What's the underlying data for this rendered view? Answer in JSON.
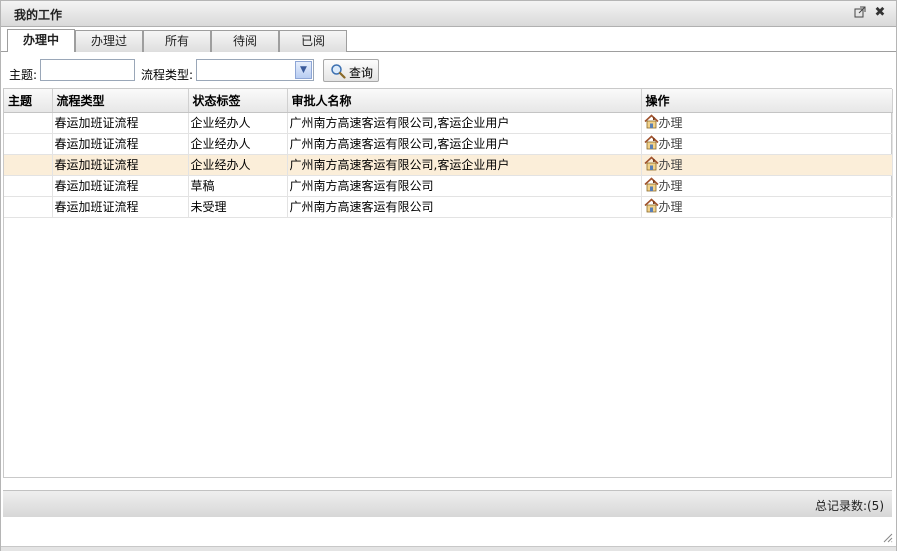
{
  "window": {
    "title": "我的工作"
  },
  "tabs": [
    {
      "label": "办理中",
      "active": true
    },
    {
      "label": "办理过",
      "active": false
    },
    {
      "label": "所有",
      "active": false
    },
    {
      "label": "待阅",
      "active": false
    },
    {
      "label": "已阅",
      "active": false
    }
  ],
  "search": {
    "subject_label": "主题:",
    "subject_value": "",
    "type_label": "流程类型:",
    "type_value": "",
    "query_button": "查询"
  },
  "table": {
    "headers": [
      "主题",
      "流程类型",
      "状态标签",
      "审批人名称",
      "操作"
    ],
    "rows": [
      {
        "subject": "",
        "type": "春运加班证流程",
        "status": "企业经办人",
        "approver": "广州南方高速客运有限公司,客运企业用户",
        "action": "办理",
        "highlighted": false
      },
      {
        "subject": "",
        "type": "春运加班证流程",
        "status": "企业经办人",
        "approver": "广州南方高速客运有限公司,客运企业用户",
        "action": "办理",
        "highlighted": false
      },
      {
        "subject": "",
        "type": "春运加班证流程",
        "status": "企业经办人",
        "approver": "广州南方高速客运有限公司,客运企业用户",
        "action": "办理",
        "highlighted": true
      },
      {
        "subject": "",
        "type": "春运加班证流程",
        "status": "草稿",
        "approver": "广州南方高速客运有限公司",
        "action": "办理",
        "highlighted": false
      },
      {
        "subject": "",
        "type": "春运加班证流程",
        "status": "未受理",
        "approver": "广州南方高速客运有限公司",
        "action": "办理",
        "highlighted": false
      }
    ]
  },
  "footer": {
    "total": "总记录数:(5)"
  },
  "icons": {
    "restore": "external-window-icon",
    "close": "close-icon",
    "search": "magnifier-icon",
    "action": "house-icon"
  },
  "colors": {
    "highlight_row": "#fbeed9"
  }
}
